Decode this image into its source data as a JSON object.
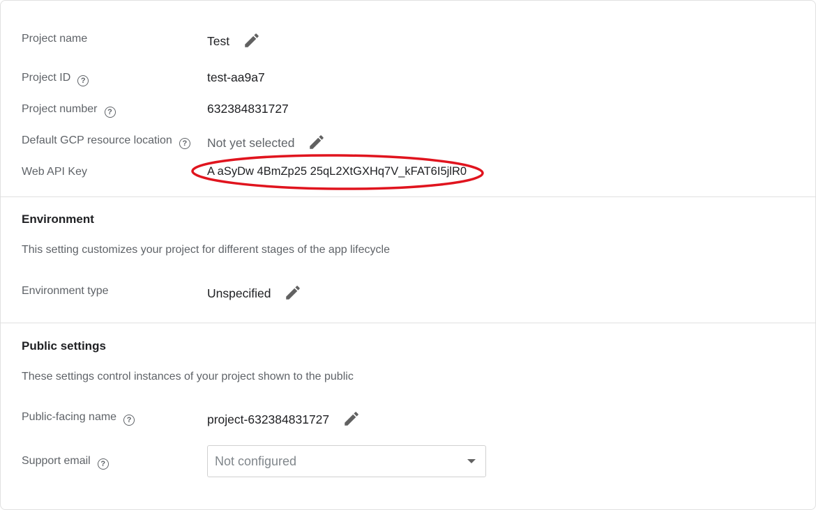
{
  "general": {
    "project_name": {
      "label": "Project name",
      "value": "Test"
    },
    "project_id": {
      "label": "Project ID",
      "value": "test-aa9a7"
    },
    "project_number": {
      "label": "Project number",
      "value": "632384831727"
    },
    "gcp_location": {
      "label": "Default GCP resource location",
      "value": "Not yet selected"
    },
    "web_api_key": {
      "label": "Web API Key",
      "value": "A  aSyDw 4BmZp25  25qL2XtGXHq7V_kFAT6I5jlR0"
    }
  },
  "environment": {
    "title": "Environment",
    "description": "This setting customizes your project for different stages of the app lifecycle",
    "type": {
      "label": "Environment type",
      "value": "Unspecified"
    }
  },
  "public_settings": {
    "title": "Public settings",
    "description": "These settings control instances of your project shown to the public",
    "public_name": {
      "label": "Public-facing name",
      "value": "project-632384831727"
    },
    "support_email": {
      "label": "Support email",
      "placeholder": "Not configured"
    }
  },
  "icons": {
    "help": "help-circle-icon",
    "edit": "pencil-icon",
    "dropdown": "caret-down-icon"
  },
  "colors": {
    "annotation": "#e0141e",
    "text": "#202124",
    "label": "#5f6368",
    "divider": "#e0e0e0"
  }
}
